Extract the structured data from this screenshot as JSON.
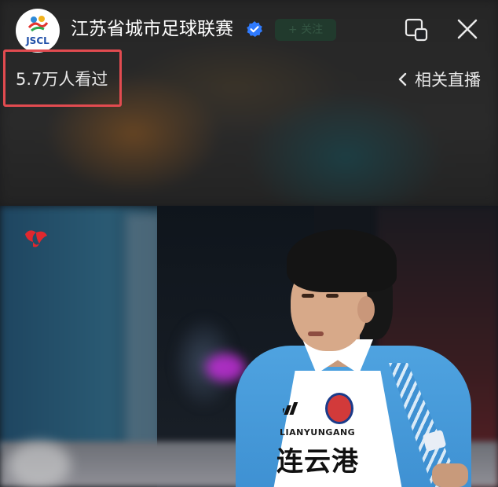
{
  "header": {
    "avatar_text": "JSCL",
    "channel_name": "江苏省城市足球联赛",
    "follow_label": "+ 关注"
  },
  "viewers": {
    "count_text": "5.7万人看过"
  },
  "related_live": {
    "label": "相关直播"
  },
  "video": {
    "jersey_sponsor_en": "LIANYUNGANG",
    "jersey_sponsor_zh": "连云港"
  },
  "icons": {
    "avatar": "jscl-logo-icon",
    "verified": "verified-check-icon",
    "mirror": "screen-mirror-icon",
    "close": "close-icon",
    "back": "chevron-left-icon",
    "broadcaster": "broadcaster-logo-icon"
  },
  "colors": {
    "accent_verified": "#2f7bff",
    "highlight_border": "#e24b50",
    "jersey_blue": "#4fa3e0"
  }
}
